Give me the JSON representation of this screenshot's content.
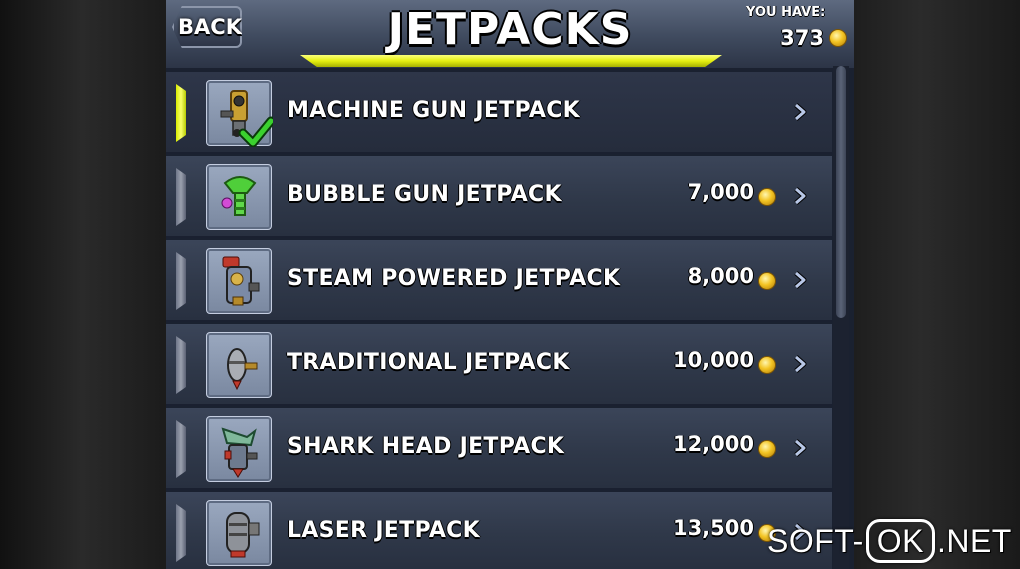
{
  "header": {
    "back_label": "BACK",
    "title": "JETPACKS",
    "you_have_label": "YOU HAVE:",
    "you_have_value": "373"
  },
  "colors": {
    "accent_yellow": "#e5ef10",
    "panel_blue": "#2f3849",
    "coin_gold": "#f3c423",
    "check_green": "#3bd12f"
  },
  "jetpacks": [
    {
      "name": "MACHINE GUN JETPACK",
      "price": "",
      "equipped": true,
      "icon": "machine-gun-jetpack-icon"
    },
    {
      "name": "BUBBLE GUN JETPACK",
      "price": "7,000",
      "equipped": false,
      "icon": "bubble-gun-jetpack-icon"
    },
    {
      "name": "STEAM POWERED JETPACK",
      "price": "8,000",
      "equipped": false,
      "icon": "steam-powered-jetpack-icon"
    },
    {
      "name": "TRADITIONAL JETPACK",
      "price": "10,000",
      "equipped": false,
      "icon": "traditional-jetpack-icon"
    },
    {
      "name": "SHARK HEAD JETPACK",
      "price": "12,000",
      "equipped": false,
      "icon": "shark-head-jetpack-icon"
    },
    {
      "name": "LASER JETPACK",
      "price": "13,500",
      "equipped": false,
      "icon": "laser-jetpack-icon"
    }
  ],
  "watermark": {
    "left": "SOFT-",
    "box": "OK",
    "right": ".NET"
  }
}
